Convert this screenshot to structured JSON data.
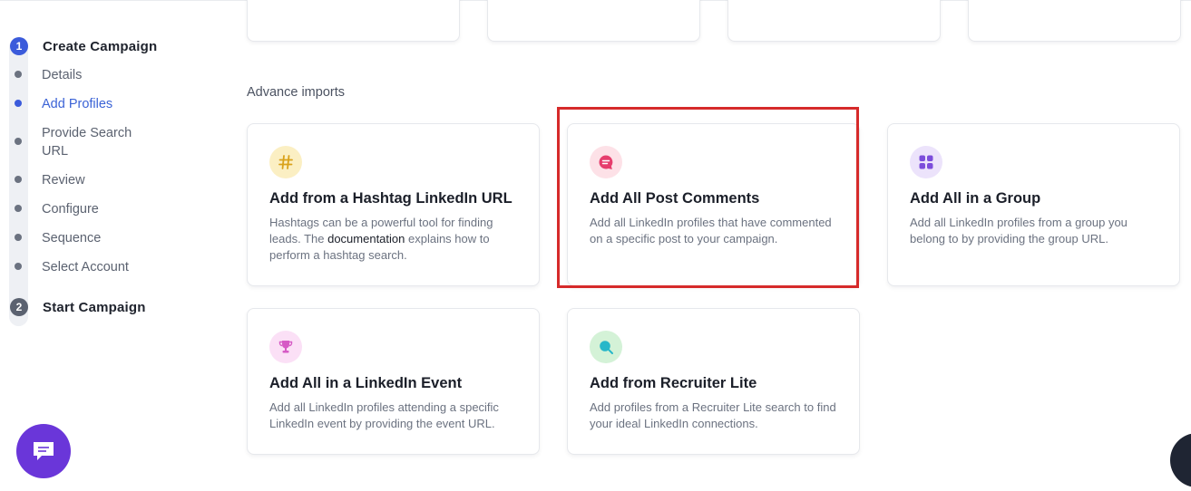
{
  "sidebar": {
    "step1": {
      "number": "1",
      "label": "Create Campaign"
    },
    "substeps": [
      {
        "label": "Details",
        "active": false
      },
      {
        "label": "Add Profiles",
        "active": true
      },
      {
        "label": "Provide Search URL",
        "active": false
      },
      {
        "label": "Review",
        "active": false
      },
      {
        "label": "Configure",
        "active": false
      },
      {
        "label": "Sequence",
        "active": false
      },
      {
        "label": "Select Account",
        "active": false
      }
    ],
    "step2": {
      "number": "2",
      "label": "Start Campaign"
    }
  },
  "section": {
    "title": "Advance imports"
  },
  "cards": [
    {
      "title": "Add from a Hashtag LinkedIn URL",
      "desc_pre": "Hashtags can be a powerful tool for finding leads. The ",
      "desc_link": "documentation",
      "desc_post": " explains how to perform a hashtag search.",
      "icon": "hashtag-icon"
    },
    {
      "title": "Add All Post Comments",
      "desc": "Add all LinkedIn profiles that have commented on a specific post to your campaign.",
      "icon": "comment-icon"
    },
    {
      "title": "Add All in a Group",
      "desc": "Add all LinkedIn profiles from a group you belong to by providing the group URL.",
      "icon": "group-grid-icon"
    },
    {
      "title": "Add All in a LinkedIn Event",
      "desc": "Add all LinkedIn profiles attending a specific LinkedIn event by providing the event URL.",
      "icon": "trophy-icon"
    },
    {
      "title": "Add from Recruiter Lite",
      "desc": "Add profiles from a Recruiter Lite search to find your ideal LinkedIn connections.",
      "icon": "search-icon"
    }
  ],
  "colors": {
    "accent": "#3b5bdb",
    "highlight": "#d62a2a",
    "chat": "#6a36d9"
  }
}
